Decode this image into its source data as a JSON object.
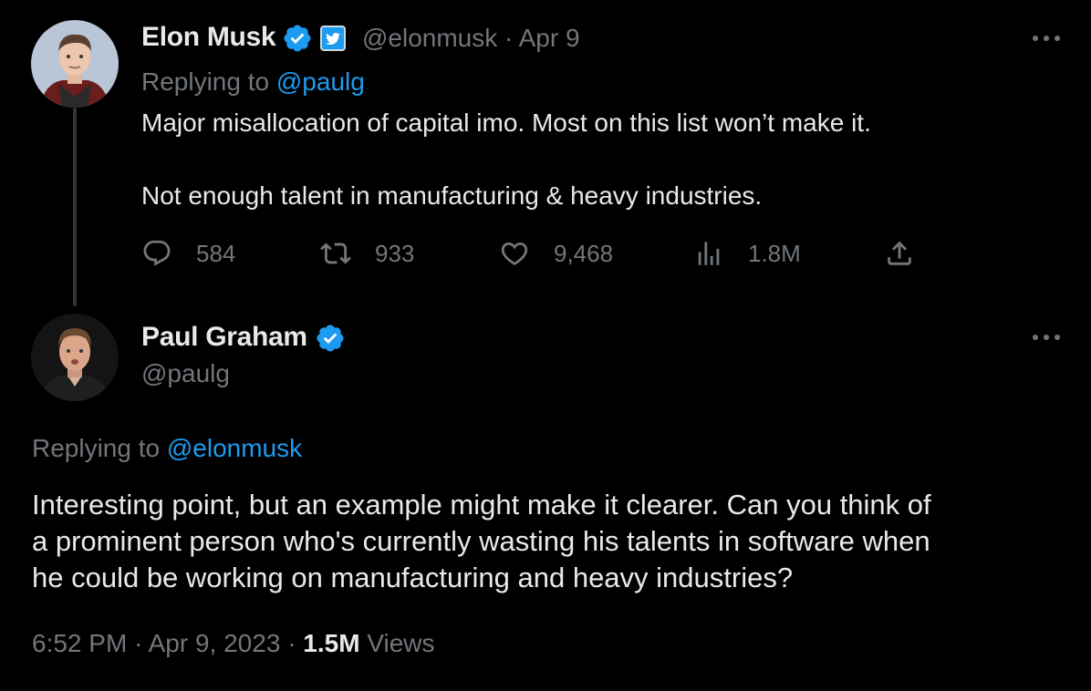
{
  "tweet1": {
    "name": "Elon Musk",
    "handle": "@elonmusk",
    "sep": "·",
    "date": "Apr 9",
    "replying_prefix": "Replying to",
    "replying_to": "@paulg",
    "text_line1": "Major misallocation of capital imo. Most on this list won’t make it.",
    "text_line2": "Not enough talent in manufacturing & heavy industries.",
    "replies": "584",
    "retweets": "933",
    "likes": "9,468",
    "views": "1.8M"
  },
  "tweet2": {
    "name": "Paul Graham",
    "handle": "@paulg",
    "replying_prefix": "Replying to",
    "replying_to": "@elonmusk",
    "text_line1": "Interesting point, but an example might make it clearer. Can you think of",
    "text_line2": "a prominent person who's currently wasting his talents in software when",
    "text_line3": "he could be working on manufacturing and heavy industries?",
    "time": "6:52 PM",
    "sep": "·",
    "date": "Apr 9, 2023",
    "views_count": "1.5M",
    "views_label": "Views"
  },
  "colors": {
    "background": "#000000",
    "text": "#e7e9ea",
    "muted": "#71767b",
    "accent": "#1d9bf0"
  },
  "icons": [
    "verified-badge-icon",
    "org-affiliation-icon",
    "more-icon",
    "reply-icon",
    "retweet-icon",
    "like-icon",
    "views-icon",
    "share-icon"
  ]
}
